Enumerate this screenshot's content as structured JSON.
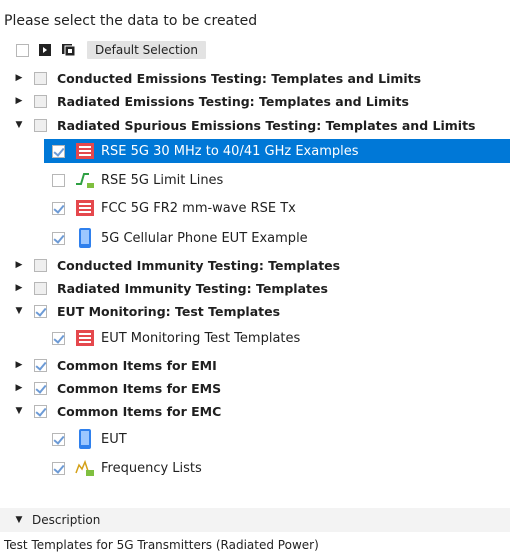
{
  "prompt": "Please select the data to be created",
  "toolbar": {
    "default_selection": "Default Selection"
  },
  "tree": {
    "items": [
      {
        "label": "Conducted Emissions Testing: Templates and Limits"
      },
      {
        "label": "Radiated Emissions Testing: Templates and Limits"
      },
      {
        "label": "Radiated Spurious Emissions Testing: Templates and Limits"
      },
      {
        "label": "RSE 5G 30 MHz to 40/41 GHz Examples"
      },
      {
        "label": "RSE 5G Limit Lines"
      },
      {
        "label": "FCC 5G FR2 mm-wave RSE Tx"
      },
      {
        "label": "5G Cellular Phone EUT Example"
      },
      {
        "label": "Conducted Immunity Testing: Templates"
      },
      {
        "label": "Radiated Immunity Testing: Templates"
      },
      {
        "label": "EUT Monitoring: Test Templates"
      },
      {
        "label": "EUT Monitoring   Test Templates"
      },
      {
        "label": "Common Items for EMI"
      },
      {
        "label": "Common Items for EMS"
      },
      {
        "label": "Common Items for EMC"
      },
      {
        "label": "EUT"
      },
      {
        "label": "Frequency Lists"
      }
    ]
  },
  "description": {
    "header": "Description",
    "text": "Test Templates for 5G Transmitters  (Radiated Power)"
  },
  "colors": {
    "selection": "#0078d7",
    "checkmark": "#6d9bd6",
    "template_icon": "#e5484d"
  }
}
